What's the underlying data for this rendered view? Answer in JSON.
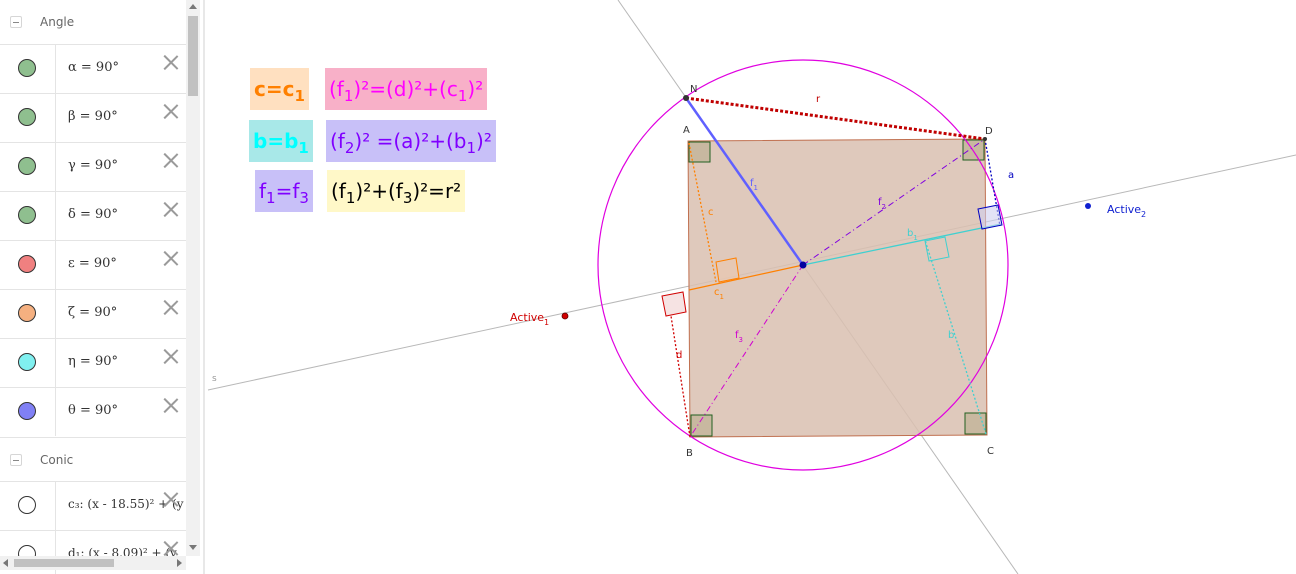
{
  "algebra": {
    "groups": [
      {
        "label": "Angle"
      },
      {
        "label": "Conic"
      }
    ],
    "angles": [
      {
        "expr": "α = 90°",
        "color": "#8fbf8f"
      },
      {
        "expr": "β = 90°",
        "color": "#8fbf8f"
      },
      {
        "expr": "γ = 90°",
        "color": "#8fbf8f"
      },
      {
        "expr": "δ = 90°",
        "color": "#8fbf8f"
      },
      {
        "expr": "ε = 90°",
        "color": "#f08080"
      },
      {
        "expr": "ζ = 90°",
        "color": "#f5b080"
      },
      {
        "expr": "η = 90°",
        "color": "#80f0f0"
      },
      {
        "expr": "θ = 90°",
        "color": "#8080f5"
      }
    ],
    "conics": [
      {
        "expr": "c₃: (x - 18.55)² + (y",
        "color": "#ffffff"
      },
      {
        "expr": "d₁: (x - 8.09)² + (y",
        "color": "#ffffff"
      }
    ]
  },
  "formulas": [
    {
      "text": "c=c",
      "sub": "1",
      "color": "#ff8000",
      "bg": "#ffe0c0"
    },
    {
      "text": "(f",
      "sub": "1",
      "tail": ")²=(d)²+(c",
      "sub2": "1",
      "tail2": ")²",
      "color": "#ff00ff",
      "bg": "#f8b0c8"
    },
    {
      "text": "b=b",
      "sub": "1",
      "color": "#00ffff",
      "bg": "#a8e8e8"
    },
    {
      "text": "(f",
      "sub": "2",
      "tail": ")² =(a)²+(b",
      "sub2": "1",
      "tail2": ")²",
      "color": "#8000ff",
      "bg": "#c8c0f8"
    },
    {
      "text": "f",
      "sub": "1",
      "tail": "=f",
      "sub2": "3",
      "tail2": "",
      "color": "#8000ff",
      "bg": "#c8c0f8"
    },
    {
      "text": "(f",
      "sub": "1",
      "tail": ")²+(f",
      "sub2": "3",
      "tail2": ")²=r²",
      "color": "#000000",
      "bg": "#fff8c8"
    }
  ],
  "labels": {
    "N": "N",
    "A": "A",
    "B": "B",
    "C": "C",
    "D": "D",
    "r": "r",
    "a": "a",
    "b": "b",
    "c": "c",
    "d": "d",
    "f1": "f",
    "f2": "f",
    "f3": "f",
    "b1": "b",
    "c1": "c",
    "s": "s",
    "active1": "Active",
    "active2": "Active",
    "sub1": "1",
    "sub2": "2",
    "sub3": "3"
  },
  "colors": {
    "square_fill": "#d9c0b0",
    "square_stroke": "#c07050",
    "circle": "#e000e0",
    "line_s": "#b0b0b0",
    "r_segment": "#c00000",
    "f1_segment": "#6060ff",
    "orange": "#ff8000",
    "cyan": "#40d0d0",
    "magenta": "#d000d0",
    "purple": "#8000e0",
    "red": "#d00000",
    "blue": "#0000c0",
    "green_angle": "#206020"
  }
}
